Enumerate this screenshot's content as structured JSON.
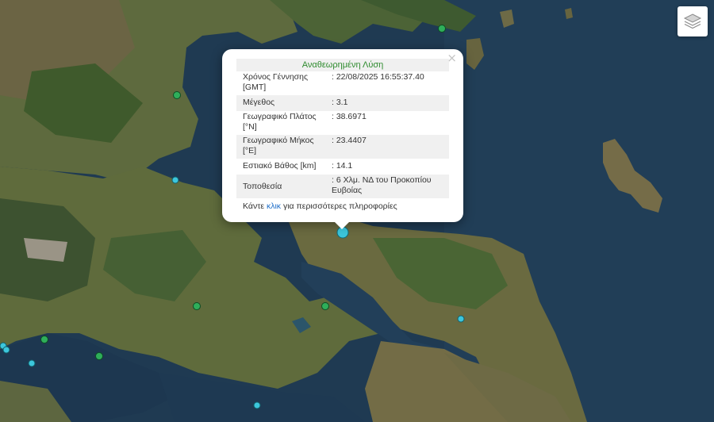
{
  "popup": {
    "title": "Αναθεωρημένη Λύση",
    "close_symbol": "×",
    "rows": [
      {
        "label": "Χρόνος Γέννησης [GMT]",
        "value": ": 22/08/2025 16:55:37.40"
      },
      {
        "label": "Μέγεθος",
        "value": ": 3.1"
      },
      {
        "label": "Γεωγραφικό Πλάτος [°N]",
        "value": ": 38.6971"
      },
      {
        "label": "Γεωγραφικό Μήκος [°E]",
        "value": ": 23.4407"
      },
      {
        "label": "Εστιακό Βάθος [km]",
        "value": ": 14.1"
      },
      {
        "label": "Τοποθεσία",
        "value": ": 6 Χλμ. ΝΔ του Προκοπίου Ευβοίας"
      }
    ],
    "more_prefix": "Κάντε ",
    "more_link": "κλικ",
    "more_suffix": " για περισσότερες πληροφορίες"
  },
  "controls": {
    "layers_icon": "layers-icon"
  },
  "colors": {
    "sea": "#1f3a52",
    "popup_title": "#2e8b2e",
    "link": "#1f6fc9",
    "marker_green": "#2fae5a",
    "marker_cyan": "#3cc6dc"
  }
}
